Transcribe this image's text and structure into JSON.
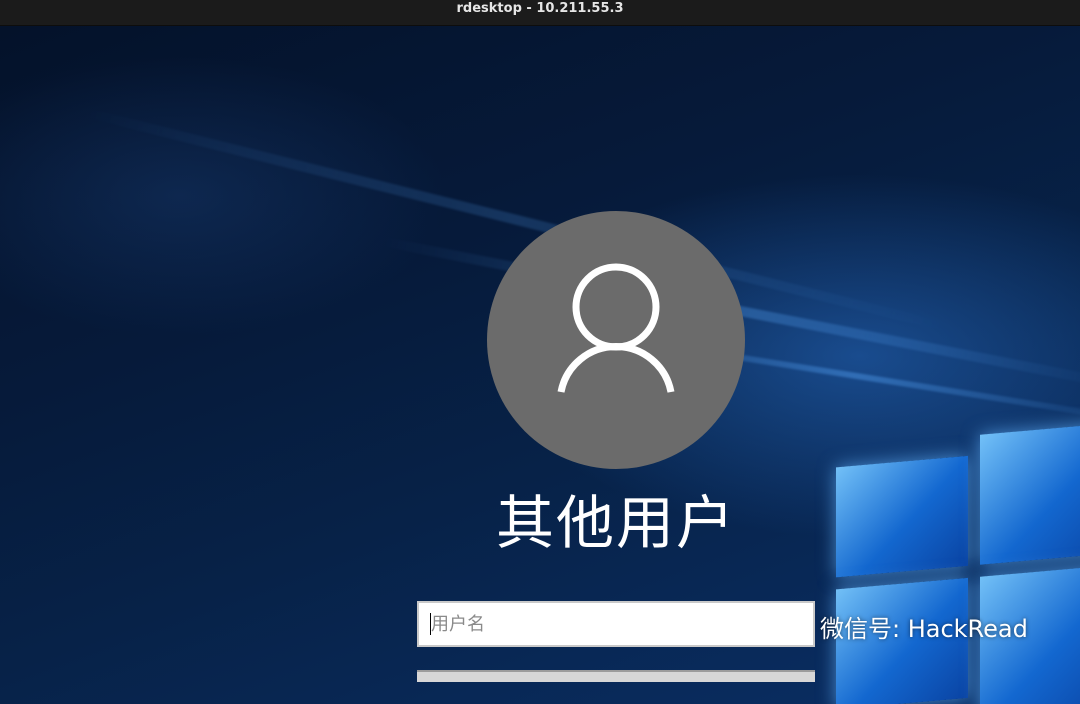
{
  "window": {
    "title": "rdesktop - 10.211.55.3"
  },
  "login": {
    "avatar_icon": "user-icon",
    "username_label": "其他用户",
    "username_placeholder": "用户名",
    "username_value": ""
  },
  "watermark": {
    "text": "微信号: HackRead",
    "icon": "wechat-logo"
  },
  "colors": {
    "titlebar": "#1b1b1b",
    "avatar_bg": "#6b6b6b",
    "background_dark": "#04122a",
    "accent_blue": "#2a7de0",
    "text_white": "#ffffff"
  }
}
